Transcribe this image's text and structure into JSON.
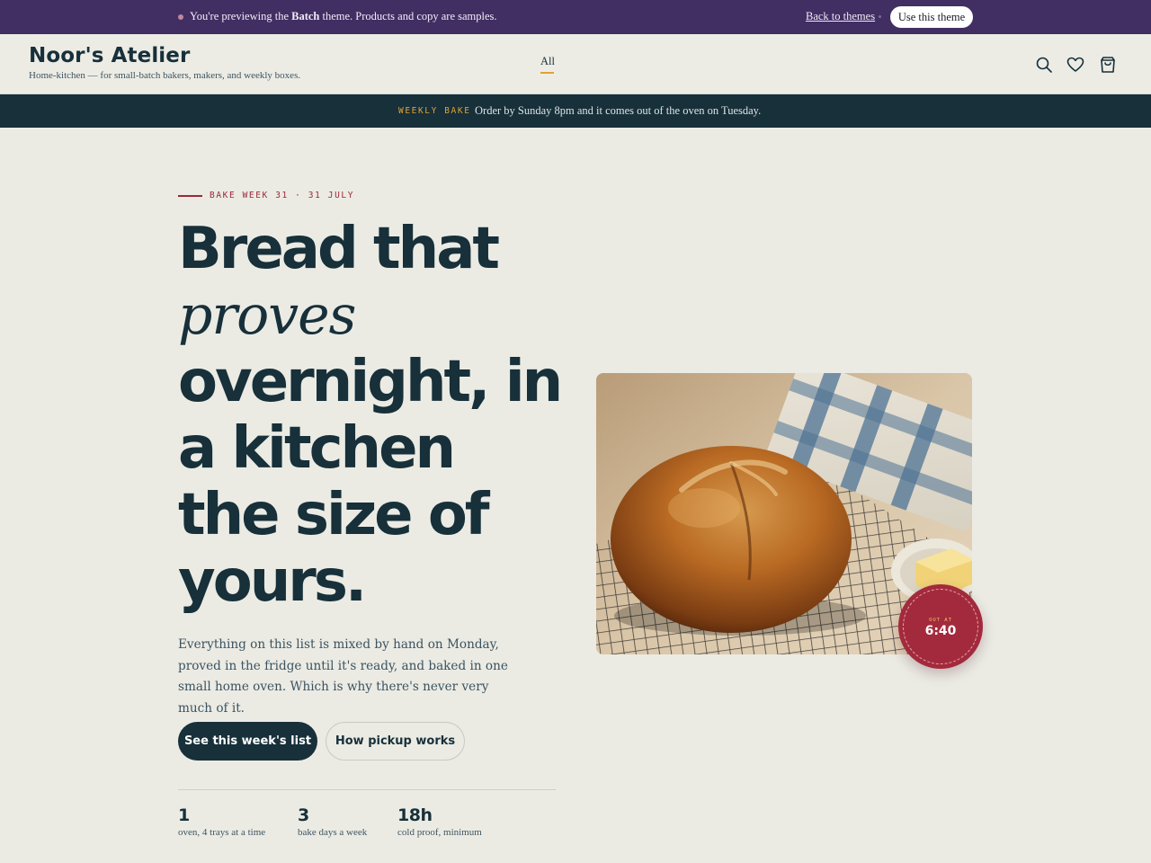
{
  "preview_bar": {
    "text_before": "You're previewing the ",
    "theme_name": "Batch",
    "text_after": " theme. Products and copy are samples.",
    "back_label": "Back to themes",
    "use_label": "Use this theme"
  },
  "header": {
    "brand": "Noor's Atelier",
    "tagline": "Home-kitchen — for small-batch bakers, makers, and weekly boxes.",
    "nav": [
      {
        "label": "All",
        "active": true
      }
    ],
    "icons": [
      "search-icon",
      "heart-icon",
      "cart-icon"
    ]
  },
  "announcement": {
    "label": "WEEKLY BAKE",
    "text": "Order by Sunday 8pm and it comes out of the oven on Tuesday."
  },
  "hero": {
    "eyebrow": "BAKE WEEK 31 · 31 JULY",
    "headline": {
      "line1": "Bread that",
      "line2": "proves",
      "line3": "overnight, in",
      "line4": "a kitchen",
      "line5": "the size of",
      "line6": "yours."
    },
    "intro": "Everything on this list is mixed by hand on Monday, proved in the fridge until it's ready, and baked in one small home oven. Which is why there's never very much of it.",
    "primary_cta": "See this week's list",
    "secondary_cta": "How pickup works",
    "stats": [
      {
        "value": "1",
        "label": "oven, 4 trays at a time"
      },
      {
        "value": "3",
        "label": "bake days a week"
      },
      {
        "value": "18h",
        "label": "cold proof, minimum"
      }
    ],
    "badge": {
      "label": "OUT AT",
      "time": "6:40"
    }
  },
  "colors": {
    "preview_bg": "#412e63",
    "ink": "#17303a",
    "accent_gold": "#e0a234",
    "accent_red": "#a32a3c",
    "page_bg": "#ebebe4"
  }
}
